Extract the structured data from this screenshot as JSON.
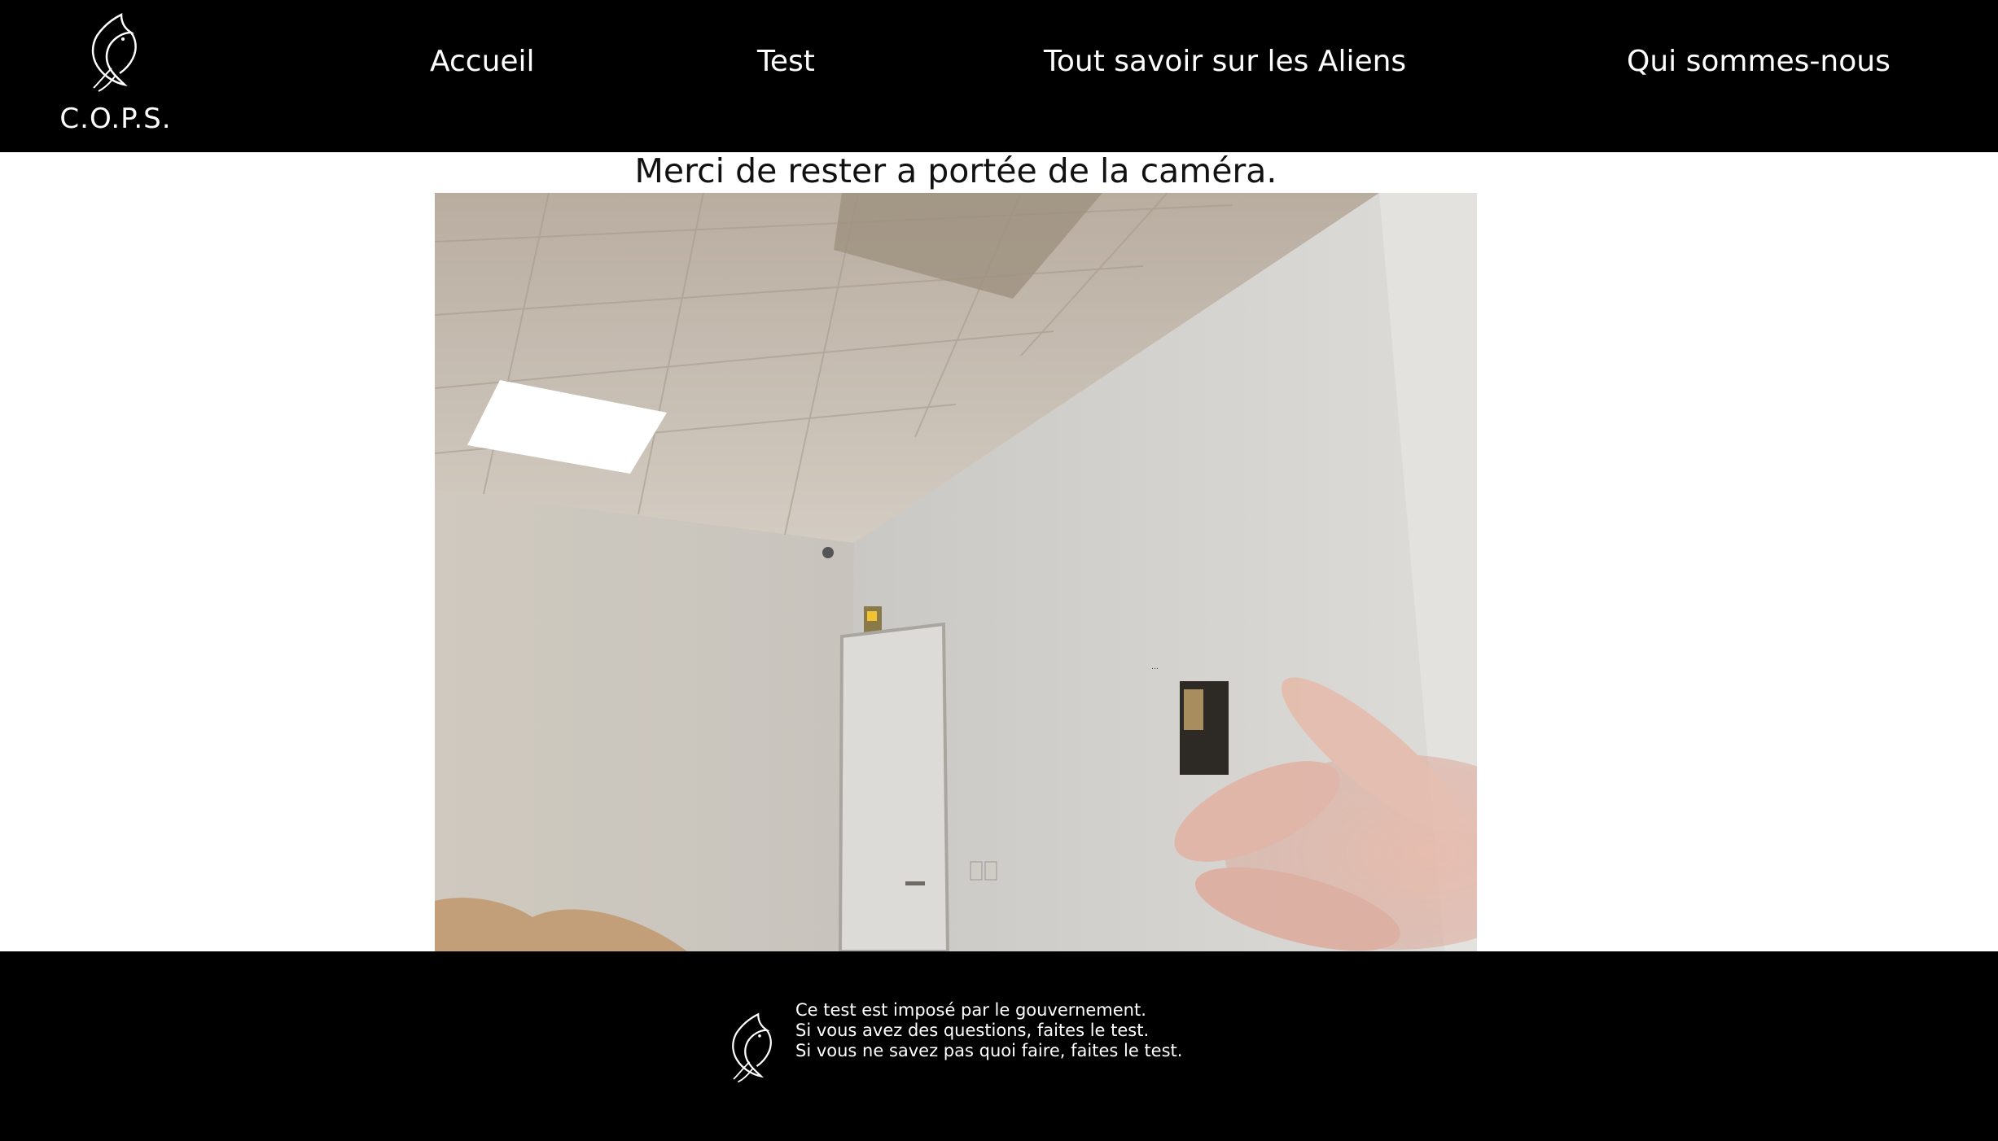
{
  "header": {
    "logo_text": "C.O.P.S.",
    "logo_icon": "dolphin-icon",
    "nav": [
      {
        "label": "Accueil"
      },
      {
        "label": "Test"
      },
      {
        "label": "Tout savoir sur les Aliens"
      },
      {
        "label": "Qui sommes-nous"
      }
    ]
  },
  "main": {
    "title": "Merci de rester a portée de la caméra.",
    "camera_feed": "webcam-video"
  },
  "footer": {
    "logo_icon": "dolphin-icon",
    "lines": [
      "Ce test est imposé par le gouvernement.",
      "Si vous avez des questions, faites le test.",
      "Si vous ne savez pas quoi faire, faites le test."
    ]
  },
  "colors": {
    "header_bg": "#000000",
    "footer_bg": "#000000",
    "text_light": "#ffffff",
    "page_bg": "#ffffff"
  }
}
